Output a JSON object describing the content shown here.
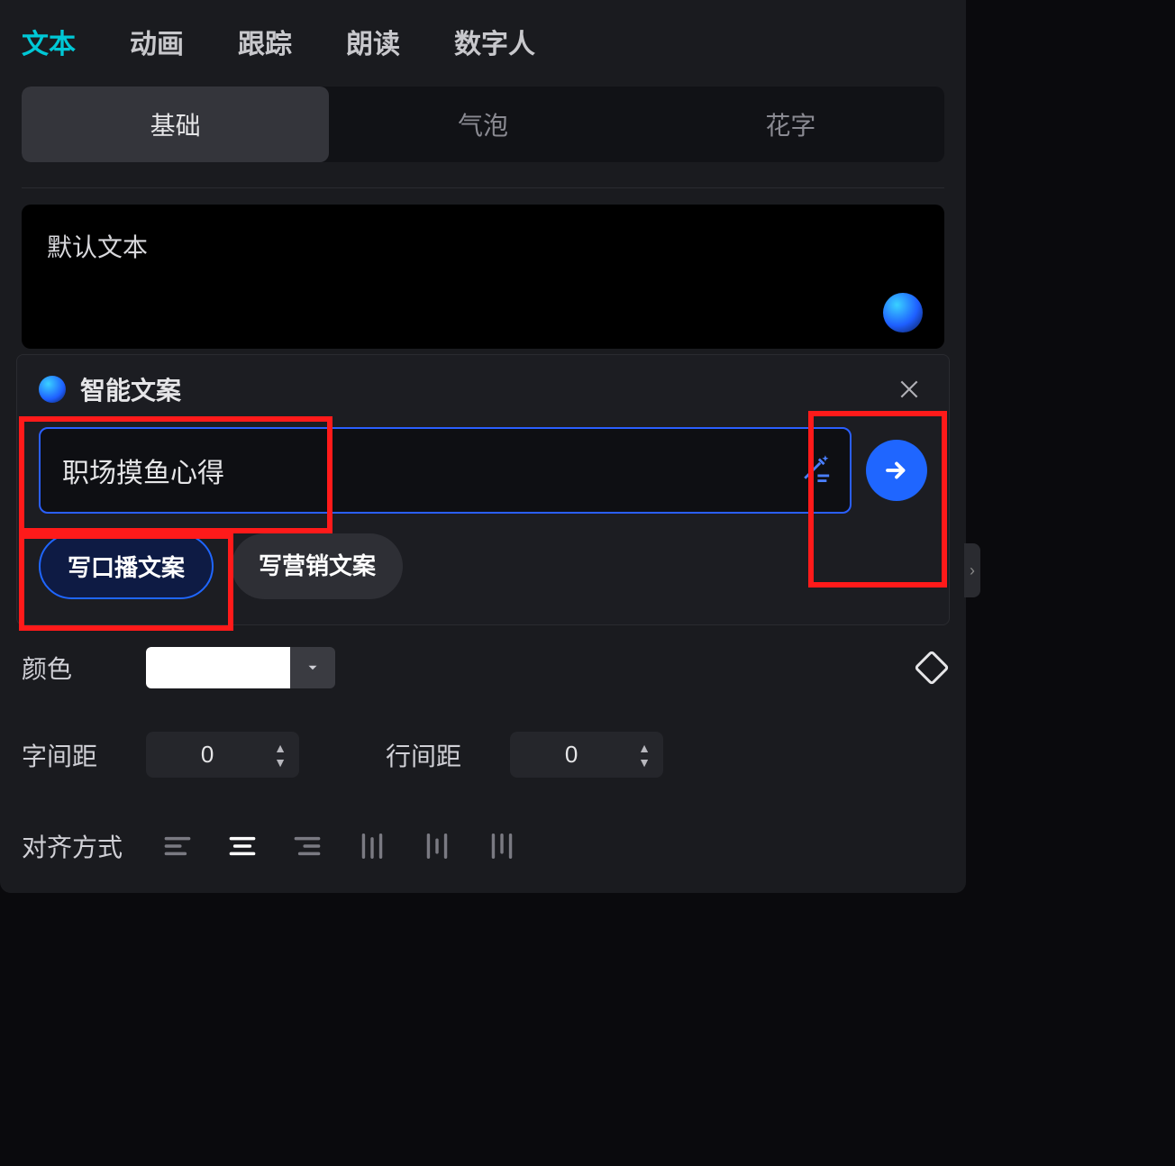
{
  "top_tabs": {
    "text": "文本",
    "animation": "动画",
    "tracking": "跟踪",
    "read": "朗读",
    "avatar": "数字人",
    "active": "text"
  },
  "sub_tabs": {
    "basic": "基础",
    "bubble": "气泡",
    "fancy": "花字",
    "active": "basic"
  },
  "text_box": {
    "default_text": "默认文本"
  },
  "popup": {
    "title": "智能文案",
    "input_value": "职场摸鱼心得",
    "chips": {
      "broadcast": "写口播文案",
      "marketing": "写营销文案",
      "active": "broadcast"
    }
  },
  "props": {
    "color_label": "颜色",
    "letter_spacing_label": "字间距",
    "letter_spacing_value": "0",
    "line_spacing_label": "行间距",
    "line_spacing_value": "0",
    "align_label": "对齐方式"
  }
}
